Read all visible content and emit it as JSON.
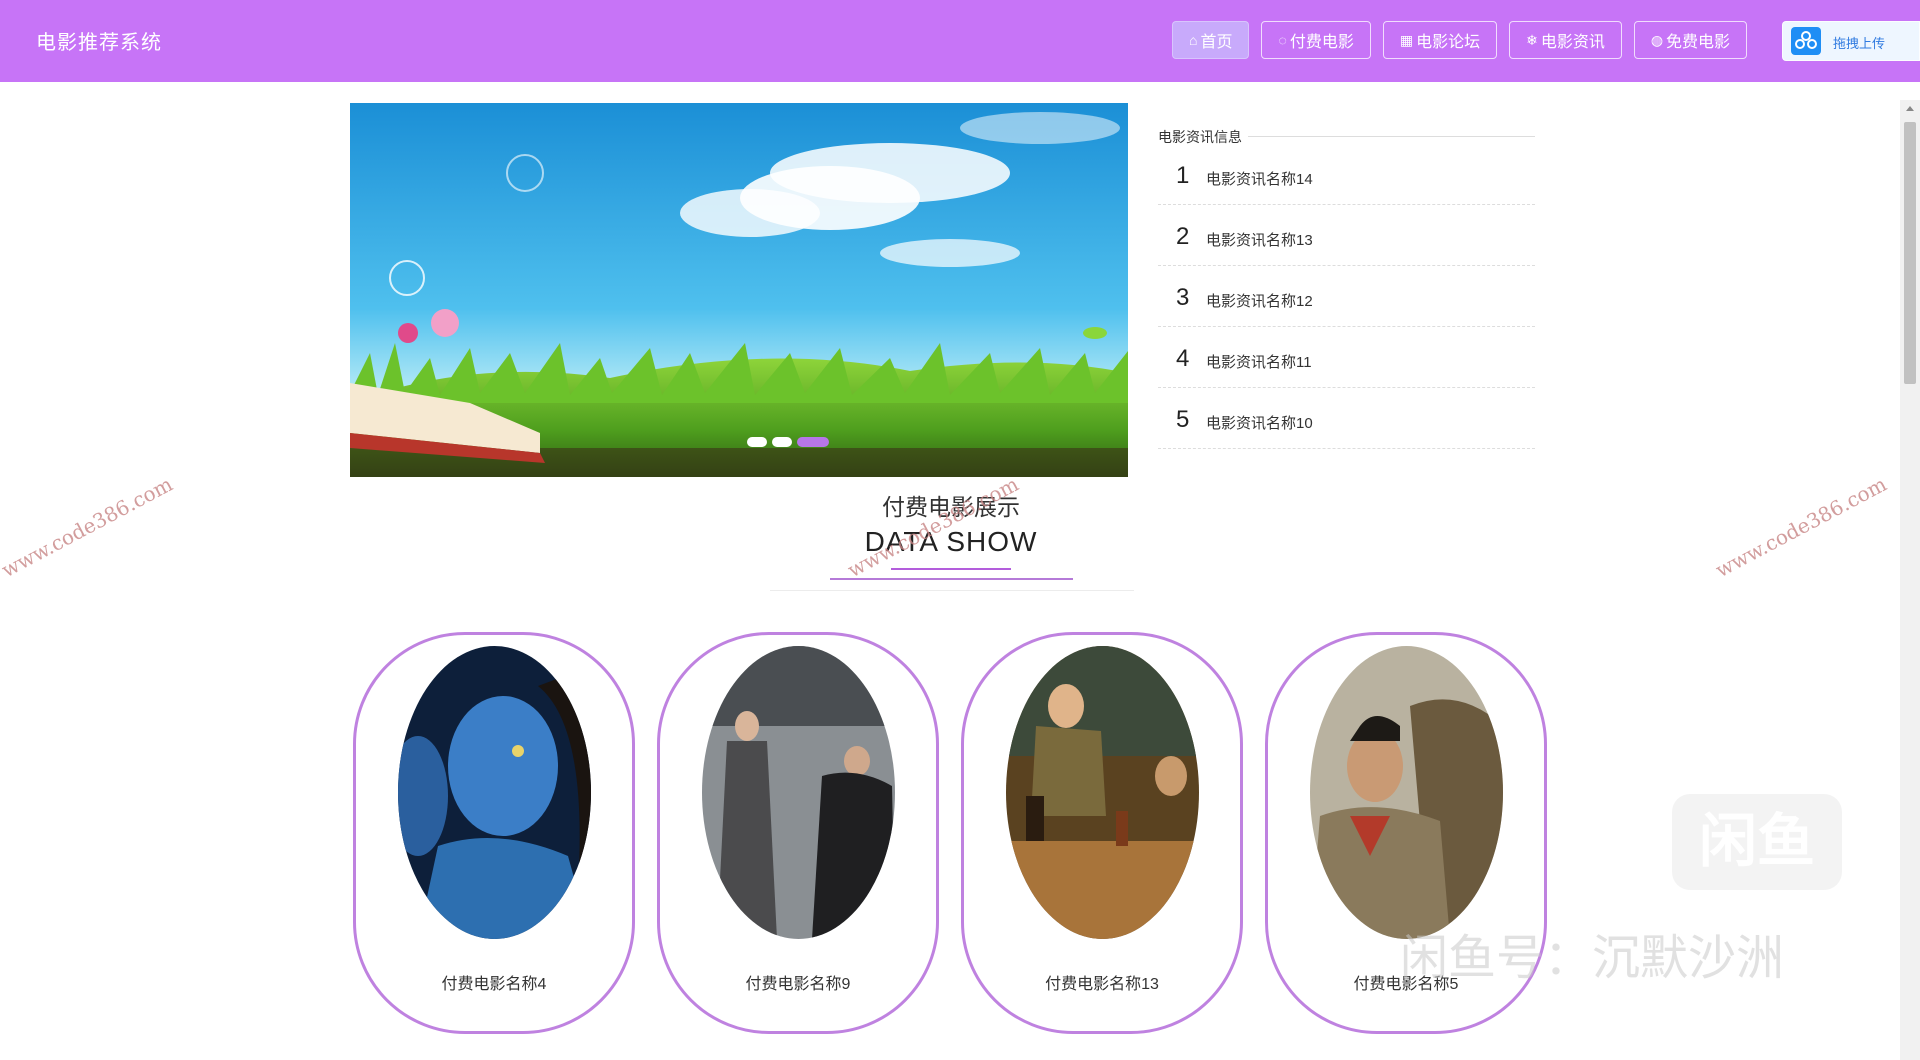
{
  "header": {
    "brand": "电影推荐系统",
    "nav": [
      {
        "icon": "home-icon",
        "glyph": "⌂",
        "label": "首页",
        "active": true
      },
      {
        "icon": "chat-icon",
        "glyph": "◌",
        "label": "付费电影",
        "active": false
      },
      {
        "icon": "grid-icon",
        "glyph": "▦",
        "label": "电影论坛",
        "active": false
      },
      {
        "icon": "snowflake-icon",
        "glyph": "❄",
        "label": "电影资讯",
        "active": false
      },
      {
        "icon": "palette-icon",
        "glyph": "◍",
        "label": "免费电影",
        "active": false
      }
    ],
    "upload_label": "拖拽上传",
    "accent_color": "#c774f7"
  },
  "banner": {
    "dots": 3,
    "active_dot": 3
  },
  "news": {
    "title": "电影资讯信息",
    "items": [
      {
        "num": "1",
        "text": "电影资讯名称14"
      },
      {
        "num": "2",
        "text": "电影资讯名称13"
      },
      {
        "num": "3",
        "text": "电影资讯名称12"
      },
      {
        "num": "4",
        "text": "电影资讯名称11"
      },
      {
        "num": "5",
        "text": "电影资讯名称10"
      }
    ]
  },
  "section": {
    "title_cn": "付费电影展示",
    "title_en": "DATA SHOW"
  },
  "movies": [
    {
      "name": "付费电影名称4"
    },
    {
      "name": "付费电影名称9"
    },
    {
      "name": "付费电影名称13"
    },
    {
      "name": "付费电影名称5"
    }
  ],
  "watermarks": {
    "site": "www.code386.com",
    "xianyu": "闲鱼号：沉默沙洲",
    "xianyu_logo": "闲鱼"
  }
}
